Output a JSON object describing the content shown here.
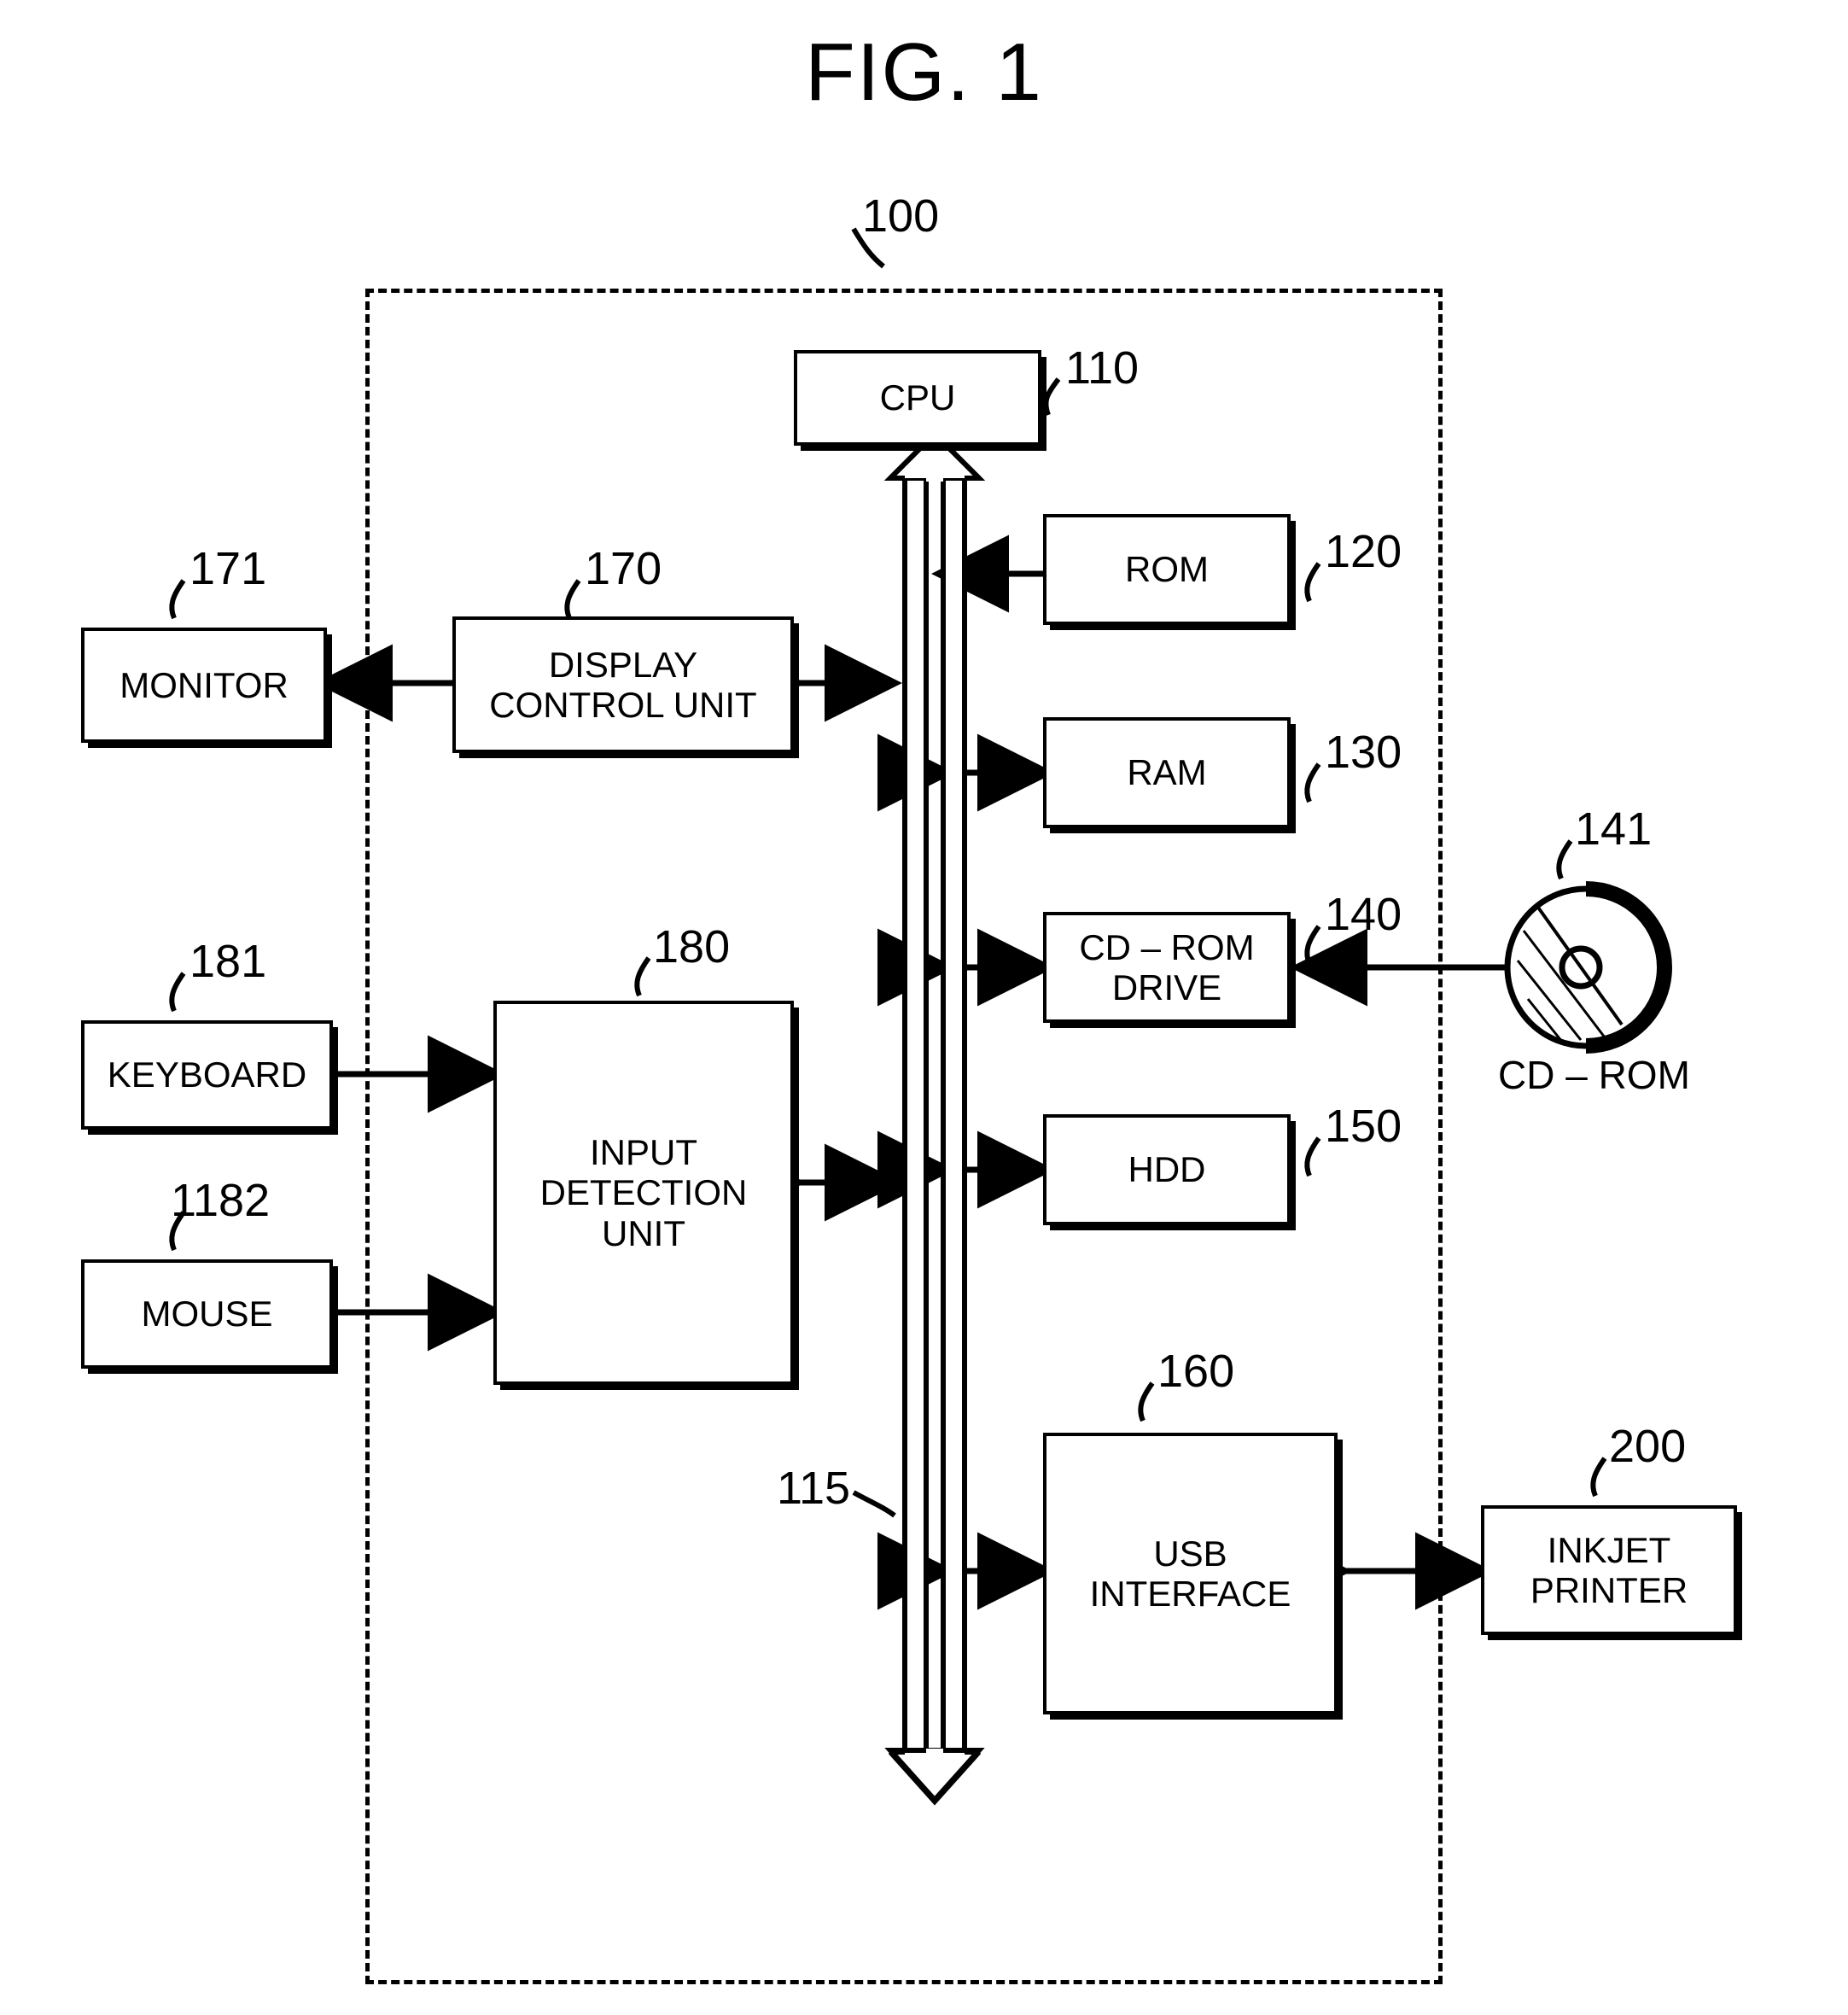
{
  "figure": {
    "title": "FIG. 1"
  },
  "blocks": {
    "cpu": {
      "label": "CPU",
      "ref": "110"
    },
    "rom": {
      "label": "ROM",
      "ref": "120"
    },
    "ram": {
      "label": "RAM",
      "ref": "130"
    },
    "cdrom_drive": {
      "label_line1": "CD – ROM",
      "label_line2": "DRIVE",
      "ref": "140"
    },
    "hdd": {
      "label": "HDD",
      "ref": "150"
    },
    "usb_interface": {
      "label_line1": "USB",
      "label_line2": "INTERFACE",
      "ref": "160"
    },
    "display_control_unit": {
      "label_line1": "DISPLAY",
      "label_line2": "CONTROL UNIT",
      "ref": "170"
    },
    "monitor": {
      "label": "MONITOR",
      "ref": "171"
    },
    "input_detection_unit": {
      "label_line1": "INPUT",
      "label_line2": "DETECTION",
      "label_line3": "UNIT",
      "ref": "180"
    },
    "keyboard": {
      "label": "KEYBOARD",
      "ref": "181"
    },
    "mouse": {
      "label": "MOUSE",
      "ref": "1182"
    },
    "inkjet_printer": {
      "label_line1": "INKJET",
      "label_line2": "PRINTER",
      "ref": "200"
    },
    "cdrom_media": {
      "label": "CD – ROM",
      "ref": "141"
    },
    "computer": {
      "ref": "100"
    },
    "bus": {
      "ref": "115"
    }
  }
}
